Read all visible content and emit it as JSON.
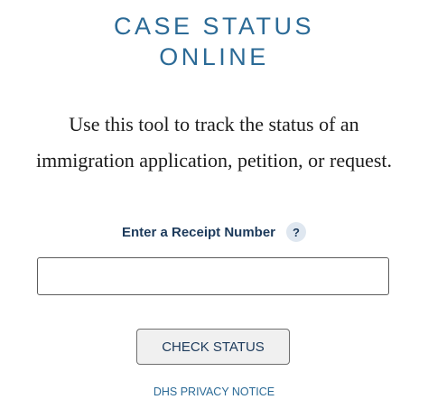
{
  "header": {
    "title_line1": "CASE STATUS",
    "title_line2": "ONLINE"
  },
  "main": {
    "description": "Use this tool to track the status of an immigration application, petition, or request.",
    "receipt_label": "Enter a Receipt Number",
    "help_icon_glyph": "?",
    "receipt_input": {
      "value": "",
      "placeholder": ""
    },
    "check_button_label": "CHECK STATUS",
    "privacy_link_label": "DHS PRIVACY NOTICE"
  },
  "colors": {
    "title": "#2b6a96",
    "label": "#1c3a5b",
    "help_icon_bg": "#dfe7f0",
    "button_bg": "#f0f0f0"
  },
  "icons": {
    "help": "question-mark-icon"
  }
}
